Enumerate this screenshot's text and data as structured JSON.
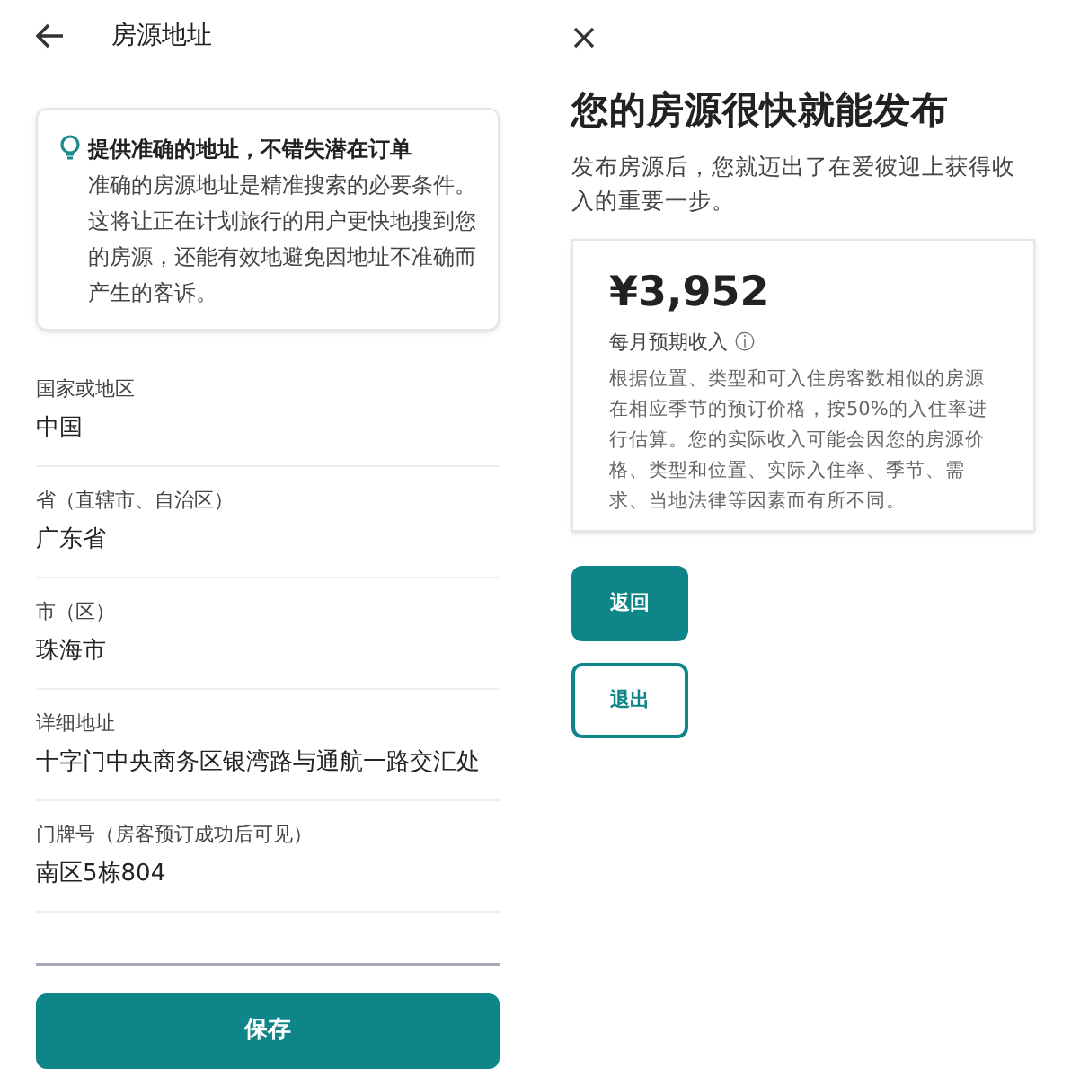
{
  "address_screen": {
    "title": "房源地址",
    "tip": {
      "heading": "提供准确的地址，不错失潜在订单",
      "body": "准确的房源地址是精准搜索的必要条件。这将让正在计划旅行的用户更快地搜到您的房源，还能有效地避免因地址不准确而产生的客诉。"
    },
    "fields": [
      {
        "label": "国家或地区",
        "value": "中国"
      },
      {
        "label": "省（直辖市、自治区）",
        "value": "广东省"
      },
      {
        "label": "市（区）",
        "value": "珠海市"
      },
      {
        "label": "详细地址",
        "value": "十字门中央商务区银湾路与通航一路交汇处"
      },
      {
        "label": "门牌号（房客预订成功后可见）",
        "value": "南区5栋804"
      }
    ],
    "blank_field": {
      "focused": true
    },
    "save_button": "保存"
  },
  "publish_screen": {
    "title": "您的房源很快就能发布",
    "subtitle": "发布房源后，您就迈出了在爱彼迎上获得收入的重要一步。",
    "estimate": {
      "amount": "¥3,952",
      "label": "每月预期收入",
      "info_icon": "ⓘ",
      "note": "根据位置、类型和可入住房客数相似的房源在相应季节的预订价格，按50%的入住率进行估算。您的实际收入可能会因您的房源价格、类型和位置、实际入住率、季节、需求、当地法律等因素而有所不同。"
    },
    "buttons": [
      {
        "label": "返回",
        "kind": "filled"
      },
      {
        "label": "退出",
        "kind": "outlined"
      }
    ]
  }
}
